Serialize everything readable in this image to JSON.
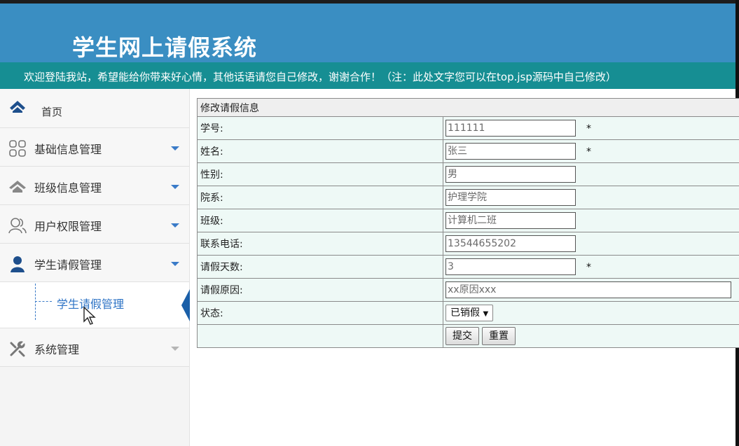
{
  "header": {
    "title": "学生网上请假系统",
    "notice": "欢迎登陆我站，希望能给你带来好心情，其他话语请您自己修改，谢谢合作！（注：此处文字您可以在top.jsp源码中自己修改）"
  },
  "sidebar": {
    "home": "首页",
    "items": [
      {
        "label": "基础信息管理",
        "icon": "grid-icon"
      },
      {
        "label": "班级信息管理",
        "icon": "home-icon"
      },
      {
        "label": "用户权限管理",
        "icon": "users-icon"
      },
      {
        "label": "学生请假管理",
        "icon": "user-icon"
      }
    ],
    "sub_item": "学生请假管理",
    "last": {
      "label": "系统管理",
      "icon": "tools-icon"
    }
  },
  "form": {
    "heading": "修改请假信息",
    "fields": {
      "student_id": {
        "label": "学号:",
        "value": "111111"
      },
      "name": {
        "label": "姓名:",
        "value": "张三"
      },
      "gender": {
        "label": "性别:",
        "value": "男"
      },
      "department": {
        "label": "院系:",
        "value": "护理学院"
      },
      "class": {
        "label": "班级:",
        "value": "计算机二班"
      },
      "phone": {
        "label": "联系电话:",
        "value": "13544655202"
      },
      "days": {
        "label": "请假天数:",
        "value": "3"
      },
      "reason": {
        "label": "请假原因:",
        "value": "xx原因xxx"
      },
      "status": {
        "label": "状态:",
        "value": "已销假"
      }
    },
    "required_mark": "*",
    "submit_label": "提交",
    "reset_label": "重置"
  },
  "colors": {
    "header": "#3a8ec2",
    "notice": "#168e93",
    "accent": "#2d73c5"
  }
}
